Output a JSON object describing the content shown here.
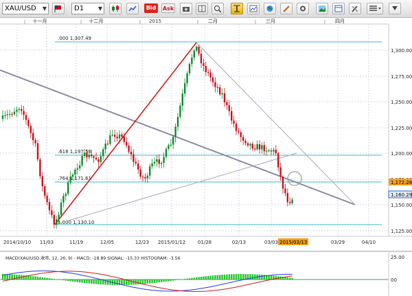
{
  "toolbar": {
    "symbol": "XAU/USD",
    "timeframe": "D1",
    "bid_label": "Bid",
    "ask_label": "Ask"
  },
  "top_axis": {
    "months": [
      "十一月",
      "十二月",
      "2015",
      "二月",
      "三月",
      "四月"
    ]
  },
  "price_axis": {
    "ticks": [
      "1,300.00",
      "1,275.00",
      "1,250.00",
      "1,225.00",
      "1,200.00",
      "1,175.00",
      "1,150.00",
      "1,125.00"
    ],
    "marker_upper": "1,172.28",
    "marker_lower": "1,160.29"
  },
  "date_axis": {
    "ticks": [
      "2014/10/10",
      "11/03",
      "11/19",
      "12/05",
      "12/23",
      "2015/01/12",
      "01/28",
      "02/13",
      "03/03",
      "03/29",
      "04/10"
    ],
    "cursor_date": "2015/03/13"
  },
  "fib_labels": {
    "level_0": ".000  1,307.49",
    "level_618": ".618  1,197.56",
    "level_764": ".764  1,171.61",
    "level_1": "1.000  1,130.10"
  },
  "macd": {
    "label": "MACD(XAU/USD,收市, 12, 26, 9) - MACD: -18.89  SIGNAL: -15.33  HISTOGRAM: -3.56",
    "axis_top": "25.00",
    "axis_zero": "00"
  },
  "colors": {
    "up": "#0c8a2a",
    "down": "#c8101a",
    "fib": "#3fb8c8",
    "trend": "#8a8aa6",
    "impulse": "#d01818",
    "accent": "#f0b400"
  }
}
